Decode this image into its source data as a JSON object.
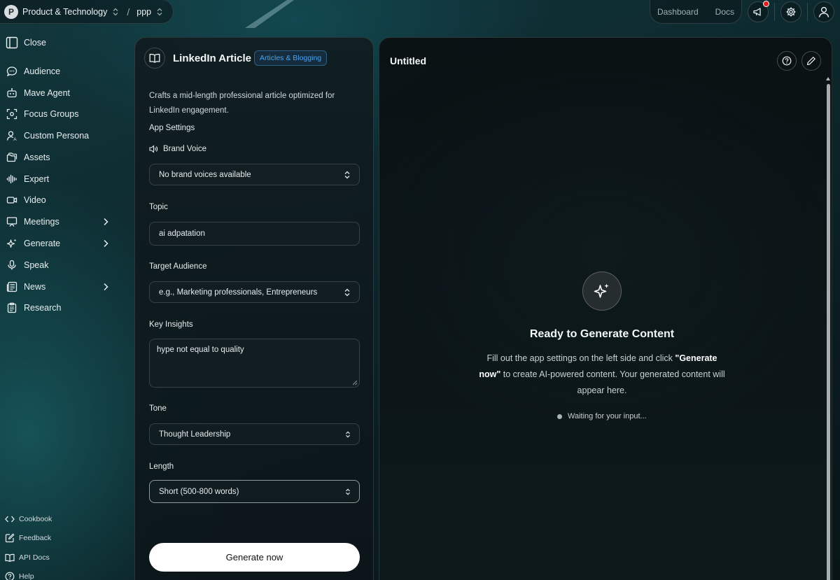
{
  "topbar": {
    "workspace_initial": "P",
    "workspace_name": "Product & Technology",
    "separator": "/",
    "project_name": "ppp",
    "nav": [
      "Dashboard",
      "Docs"
    ]
  },
  "sidebar": {
    "close_label": "Close",
    "items": [
      {
        "label": "Audience",
        "icon": "chat-bubble-icon"
      },
      {
        "label": "Mave Agent",
        "icon": "robot-icon"
      },
      {
        "label": "Focus Groups",
        "icon": "focus-target-icon"
      },
      {
        "label": "Custom Persona",
        "icon": "persona-icon"
      },
      {
        "label": "Assets",
        "icon": "folders-icon"
      },
      {
        "label": "Expert",
        "icon": "waveform-icon"
      },
      {
        "label": "Video",
        "icon": "video-camera-icon"
      },
      {
        "label": "Meetings",
        "icon": "presentation-icon",
        "has_submenu": true
      },
      {
        "label": "Generate",
        "icon": "sparkles-icon",
        "has_submenu": true
      },
      {
        "label": "Speak",
        "icon": "microphone-icon"
      },
      {
        "label": "News",
        "icon": "newspaper-icon",
        "has_submenu": true
      },
      {
        "label": "Research",
        "icon": "clipboard-icon"
      }
    ],
    "bottom": [
      {
        "label": "Cookbook",
        "icon": "code-brackets-icon"
      },
      {
        "label": "Feedback",
        "icon": "edit-square-icon"
      },
      {
        "label": "API Docs",
        "icon": "open-book-icon"
      },
      {
        "label": "Help",
        "icon": "help-circle-icon"
      }
    ]
  },
  "form": {
    "app_title": "LinkedIn Article",
    "app_badge": "Articles & Blogging",
    "description": "Crafts a mid-length professional article optimized for LinkedIn engagement.",
    "settings_heading": "App Settings",
    "brand_voice_label": "Brand Voice",
    "brand_voice_value": "No brand voices available",
    "topic_label": "Topic",
    "topic_value": "ai adpatation",
    "audience_label": "Target Audience",
    "audience_placeholder": "e.g., Marketing professionals, Entrepreneurs",
    "insights_label": "Key Insights",
    "insights_value": "hype not equal to quality",
    "tone_label": "Tone",
    "tone_value": "Thought Leadership",
    "length_label": "Length",
    "length_value": "Short (500-800 words)",
    "generate_label": "Generate now"
  },
  "output": {
    "doc_title": "Untitled",
    "ready_title": "Ready to Generate Content",
    "ready_desc_pre": "Fill out the app settings on the left side and click ",
    "ready_desc_bold": "\"Generate now\"",
    "ready_desc_post": " to create AI-powered content. Your generated content will appear here.",
    "waiting_text": "Waiting for your input..."
  },
  "colors": {
    "accent_badge": "#4aa3f0",
    "notification": "#e81c1c",
    "primary_button": "#ffffff"
  }
}
